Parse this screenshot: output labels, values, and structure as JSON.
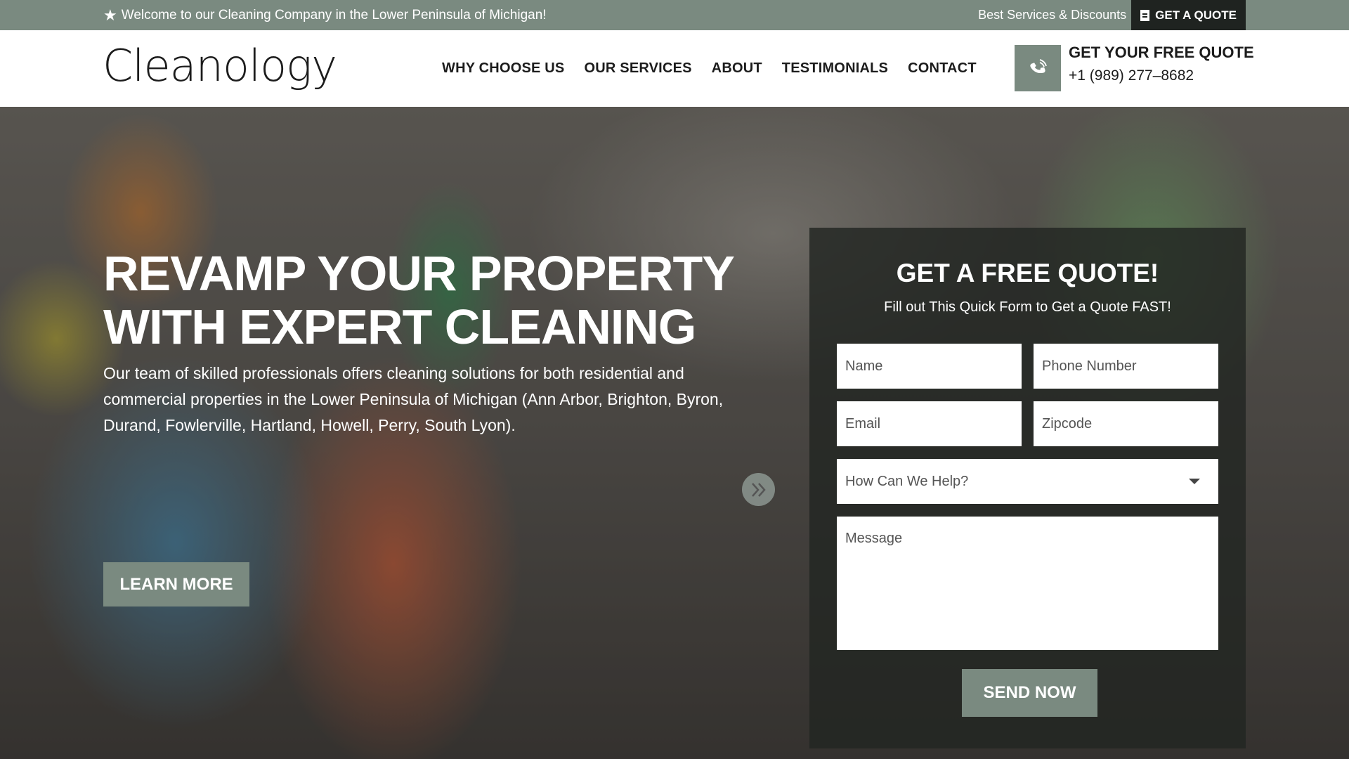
{
  "topbar": {
    "welcome": "Welcome to our Cleaning Company in the Lower Peninsula of Michigan!",
    "promo": "Best Services & Discounts",
    "quote_button": "GET A QUOTE"
  },
  "header": {
    "logo": "Cleanology",
    "nav": [
      "WHY CHOOSE US",
      "OUR SERVICES",
      "ABOUT",
      "TESTIMONIALS",
      "CONTACT"
    ],
    "contact_title": "GET YOUR FREE QUOTE",
    "contact_phone": "+1 (989) 277–8682"
  },
  "hero": {
    "headline_line1": "REVAMP YOUR PROPERTY",
    "headline_line2": "WITH EXPERT CLEANING",
    "description": "Our team of skilled professionals offers cleaning solutions for both residential and commercial properties in the Lower Peninsula of Michigan (Ann Arbor, Brighton, Byron, Durand, Fowlerville, Hartland, Howell, Perry, South Lyon).",
    "button": "LEARN MORE"
  },
  "form": {
    "title": "GET A FREE QUOTE!",
    "subtitle": "Fill out This Quick Form to Get a Quote FAST!",
    "name_placeholder": "Name",
    "phone_placeholder": "Phone Number",
    "email_placeholder": "Email",
    "zip_placeholder": "Zipcode",
    "help_select": "How Can We Help?",
    "message_placeholder": "Message",
    "submit": "SEND NOW"
  },
  "colors": {
    "accent": "#7a8a80",
    "dark": "#1f2320"
  },
  "icons": [
    "star-icon",
    "document-icon",
    "phone-icon",
    "chevron-right-double-icon",
    "caret-down-icon"
  ]
}
